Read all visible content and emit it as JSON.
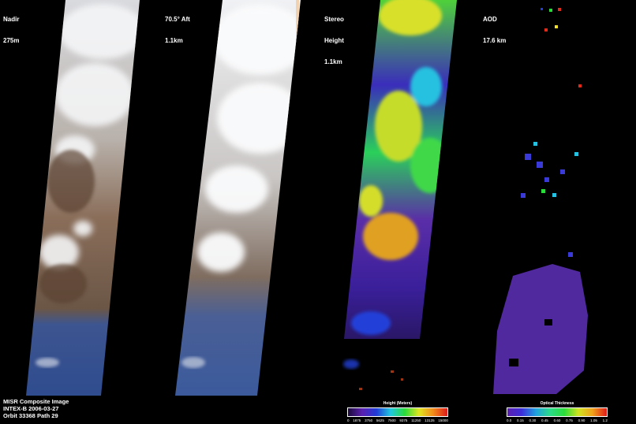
{
  "panels": [
    {
      "title": "Nadir",
      "subtitle": "275m"
    },
    {
      "title": "70.5° Aft",
      "subtitle": "1.1km"
    },
    {
      "title": "Stereo",
      "subtitle": "Height",
      "subtitle2": "1.1km"
    },
    {
      "title": "AOD",
      "subtitle": "17.6 km"
    }
  ],
  "footer": {
    "line1": "MISR Composite Image",
    "line2": "INTEX-B  2006-03-27",
    "line3": "Orbit 33368 Path 29"
  },
  "height_bar": {
    "title": "Height (Meters)",
    "ticks": [
      "0",
      "1875",
      "3750",
      "5625",
      "7500",
      "9375",
      "11250",
      "13125",
      "15000"
    ]
  },
  "aod_bar": {
    "title": "Optical Thickness",
    "ticks": [
      "0.0",
      "0.15",
      "0.30",
      "0.45",
      "0.60",
      "0.75",
      "0.90",
      "1.05",
      "1.2"
    ]
  },
  "colors": {
    "background": "#000000",
    "label": "#ffffff"
  }
}
